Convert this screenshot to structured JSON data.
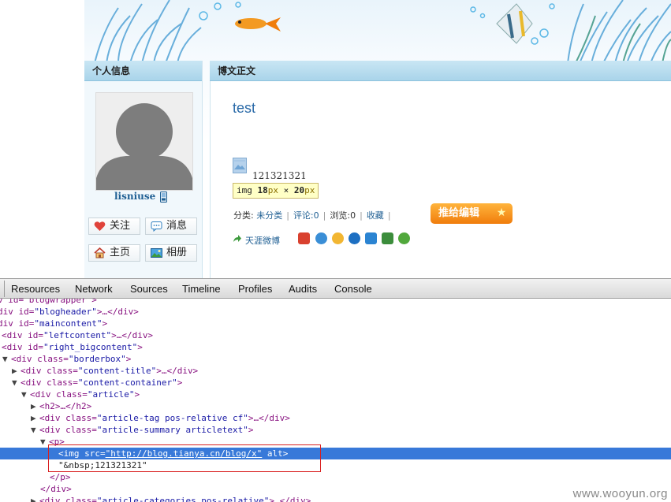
{
  "blog": {
    "left_panel_title": "个人信息",
    "right_panel_title": "博文正文",
    "username": "lisniuse",
    "buttons": {
      "follow": "关注",
      "message": "消息",
      "home": "主页",
      "album": "相册"
    },
    "post": {
      "title": "test",
      "summary_text": "121321321",
      "tooltip": {
        "tag": "img",
        "width": "18",
        "height": "20",
        "unit": "px",
        "times": "×"
      },
      "meta": {
        "category_label": "分类:",
        "category_value": "未分类",
        "comment": "评论:0",
        "views": "浏览:0",
        "favorite": "收藏",
        "sep": "|"
      },
      "recommend_button": "推给编辑",
      "share_label": "天涯微博"
    },
    "colors": {
      "link": "#1f5f93",
      "accent_orange": "#f07d0c"
    }
  },
  "devtools": {
    "tabs": [
      "Resources",
      "Network",
      "Sources",
      "Timeline",
      "Profiles",
      "Audits",
      "Console"
    ],
    "tree": [
      {
        "text_tag": "v id=\"blogwrapper\">",
        "partial": true
      },
      {
        "l0": "div id=\"blogheader\">…</div>"
      },
      {
        "l1": "div id=\"maincontent\">"
      },
      {
        "l2": "<div id=\"leftcontent\">…</div>"
      },
      {
        "l3": "<div id=\"right_bigcontent\">"
      },
      {
        "l4": "▼<div class=\"borderbox\">"
      }
    ],
    "lines": {
      "l0": "v id=\"blogwrapper\">",
      "l1a": "div id=",
      "l1b": "\"blogheader\"",
      "l1c": ">…</div>",
      "l2a": "div id=",
      "l2b": "\"maincontent\"",
      "l2c": ">",
      "l3a": "<div id=",
      "l3b": "\"leftcontent\"",
      "l3c": ">…</div>",
      "l4a": "<div id=",
      "l4b": "\"right_bigcontent\"",
      "l4c": ">",
      "l5a": "<div class=",
      "l5b": "\"borderbox\"",
      "l5c": ">",
      "l6a": "<div class=",
      "l6b": "\"content-title\"",
      "l6c": ">…</div>",
      "l7a": "<div class=",
      "l7b": "\"content-container\"",
      "l7c": ">",
      "l8a": "<div class=",
      "l8b": "\"article\"",
      "l8c": ">",
      "l9": "<h2>…</h2>",
      "l10a": "<div class=",
      "l10b": "\"article-tag pos-relative cf\"",
      "l10c": ">…</div>",
      "l11a": "<div class=",
      "l11b": "\"article-summary articletext\"",
      "l11c": ">",
      "l12": "<p>",
      "l13a": "<img src=",
      "l13b": "\"http://blog.tianya.cn/blog/x\"",
      "l13c": " alt>",
      "l14": "\"&nbsp;121321321\"",
      "l15": "</p>",
      "l16": "</div>",
      "l17a": "<div class=",
      "l17b": "\"article-categories pos-relative\"",
      "l17c": ">…</div>"
    },
    "selection_color": "#3879d9"
  },
  "watermark": "www.wooyun.org"
}
